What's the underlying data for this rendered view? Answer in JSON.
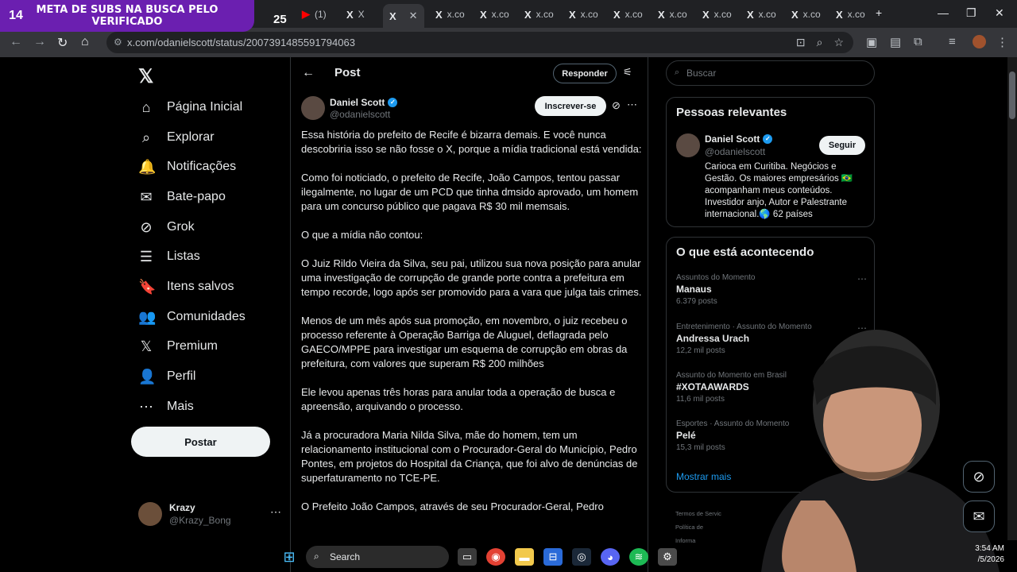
{
  "stream_overlay": {
    "number": "14",
    "text": "META DE SUBS NA BUSCA PELO VERIFICADO",
    "count": "25"
  },
  "tabs": [
    {
      "icon": "(1)",
      "label": "(1)"
    },
    {
      "icon": "X",
      "label": "X"
    },
    {
      "icon": "X",
      "label": ""
    },
    {
      "icon": "X",
      "label": "x.co"
    },
    {
      "icon": "X",
      "label": "x.co"
    },
    {
      "icon": "X",
      "label": "x.co"
    },
    {
      "icon": "X",
      "label": "x.co"
    },
    {
      "icon": "X",
      "label": "x.co"
    },
    {
      "icon": "X",
      "label": "x.co"
    },
    {
      "icon": "X",
      "label": "x.co"
    },
    {
      "icon": "X",
      "label": "x.co"
    },
    {
      "icon": "X",
      "label": "x.co"
    }
  ],
  "address_bar": {
    "url": "x.com/odanielscott/status/2007391485591794063"
  },
  "nav": {
    "items": [
      {
        "label": "Página Inicial",
        "icon": "home-icon",
        "glyph": "⌂"
      },
      {
        "label": "Explorar",
        "icon": "search-icon",
        "glyph": "⌕"
      },
      {
        "label": "Notificações",
        "icon": "bell-icon",
        "glyph": "🔔"
      },
      {
        "label": "Bate-papo",
        "icon": "mail-icon",
        "glyph": "✉"
      },
      {
        "label": "Grok",
        "icon": "grok-icon",
        "glyph": "⊘"
      },
      {
        "label": "Listas",
        "icon": "list-icon",
        "glyph": "☰"
      },
      {
        "label": "Itens salvos",
        "icon": "bookmark-icon",
        "glyph": "🔖"
      },
      {
        "label": "Comunidades",
        "icon": "communities-icon",
        "glyph": "👥"
      },
      {
        "label": "Premium",
        "icon": "x-premium-icon",
        "glyph": "𝕏"
      },
      {
        "label": "Perfil",
        "icon": "profile-icon",
        "glyph": "👤"
      },
      {
        "label": "Mais",
        "icon": "more-icon",
        "glyph": "⋯"
      }
    ],
    "post_button": "Postar",
    "me": {
      "name": "Krazy",
      "handle": "@Krazy_Bong"
    }
  },
  "post": {
    "header_title": "Post",
    "reply_button": "Responder",
    "author": {
      "name": "Daniel Scott",
      "handle": "@odanielscott"
    },
    "subscribe_button": "Inscrever-se",
    "paragraphs": [
      "Essa história do prefeito de Recife é bizarra demais. E você nunca descobriria isso se não fosse o X, porque a mídia tradicional está vendida:",
      "Como foi noticiado, o prefeito de Recife, João Campos, tentou passar ilegalmente, no lugar de um PCD que tinha dmsido aprovado, um homem para um concurso público que pagava R$ 30 mil memsais.",
      "O que a mídia não contou:",
      "O Juiz Rildo Vieira da Silva, seu pai, utilizou sua nova posição para anular uma investigação de corrupção de grande porte contra a prefeitura em tempo recorde, logo após ser promovido para a vara que julga tais crimes.",
      "Menos de um mês após sua promoção, em novembro, o juiz recebeu o processo referente à Operação Barriga de Aluguel, deflagrada pelo GAECO/MPPE para investigar um esquema de corrupção em obras da prefeitura, com valores que superam R$ 200 milhões",
      "Ele levou apenas três horas para anular toda a operação de busca e apreensão, arquivando o processo.",
      "Já a procuradora Maria Nilda Silva, mãe do homem, tem um relacionamento institucional com o Procurador-Geral do Município, Pedro Pontes, em projetos do Hospital da Criança, que foi alvo de denúncias de superfaturamento no TCE-PE.",
      "O Prefeito João Campos, através de seu Procurador-Geral, Pedro"
    ]
  },
  "sidebar": {
    "search_placeholder": "Buscar",
    "relevant": {
      "title": "Pessoas relevantes",
      "name": "Daniel Scott",
      "handle": "@odanielscott",
      "follow_button": "Seguir",
      "bio": "Carioca em Curitiba. Negócios e Gestão. Os maiores empresários 🇧🇷 acompanham meus conteúdos. Investidor anjo, Autor e Palestrante internacional.🌎 62 países"
    },
    "happening": {
      "title": "O que está acontecendo",
      "trends": [
        {
          "context": "Assuntos do Momento",
          "name": "Manaus",
          "count": "6.379 posts"
        },
        {
          "context": "Entretenimento · Assunto do Momento",
          "name": "Andressa Urach",
          "count": "12,2 mil posts"
        },
        {
          "context": "Assunto do Momento em Brasil",
          "name": "#XOTAAWARDS",
          "count": "11,6 mil posts"
        },
        {
          "context": "Esportes · Assunto do Momento",
          "name": "Pelé",
          "count": "15,3 mil posts"
        }
      ],
      "show_more": "Mostrar mais"
    },
    "footer": [
      "Termos de Servic",
      "Política de",
      "Informa"
    ]
  },
  "taskbar": {
    "search_label": "Search"
  },
  "tray": {
    "time": "3:54 AM",
    "date": "/5/2026"
  }
}
